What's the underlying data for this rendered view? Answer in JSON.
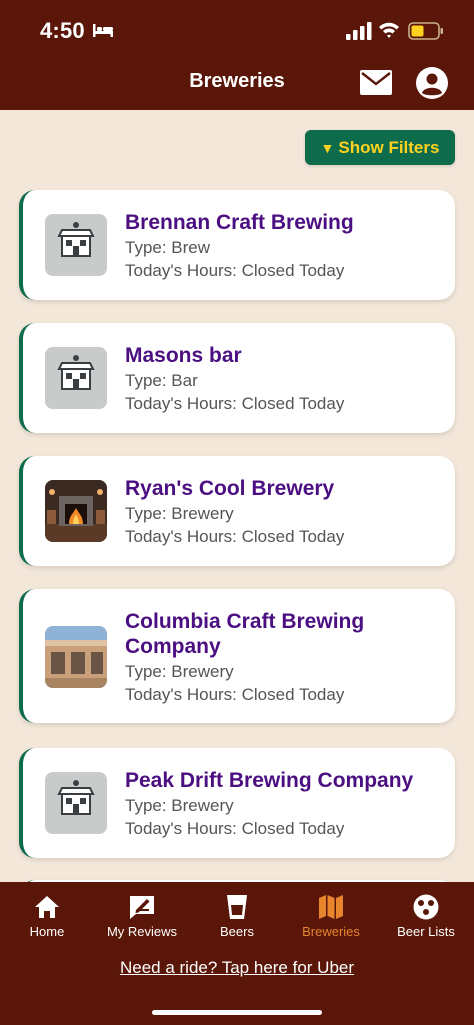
{
  "status_bar": {
    "time": "4:50"
  },
  "header": {
    "title": "Breweries"
  },
  "filters": {
    "label": "Show Filters",
    "icon": "triangle-down-icon"
  },
  "breweries": [
    {
      "name": "Brennan Craft Brewing",
      "type": "Type: Brew",
      "hours": "Today's Hours: Closed Today",
      "image": "storefront-placeholder"
    },
    {
      "name": "Masons bar",
      "type": "Type: Bar",
      "hours": "Today's Hours: Closed Today",
      "image": "storefront-placeholder"
    },
    {
      "name": "Ryan's Cool Brewery",
      "type": "Type: Brewery",
      "hours": "Today's Hours: Closed Today",
      "image": "fireplace-photo"
    },
    {
      "name": "Columbia Craft Brewing Company",
      "type": "Type: Brewery",
      "hours": "Today's Hours: Closed Today",
      "image": "building-photo"
    },
    {
      "name": "Peak Drift Brewing Company",
      "type": "Type: Brewery",
      "hours": "Today's Hours: Closed Today",
      "image": "storefront-placeholder"
    }
  ],
  "tabs": [
    {
      "label": "Home",
      "icon": "home-icon"
    },
    {
      "label": "My Reviews",
      "icon": "review-icon"
    },
    {
      "label": "Beers",
      "icon": "beer-cup-icon"
    },
    {
      "label": "Breweries",
      "icon": "map-icon",
      "active": true
    },
    {
      "label": "Beer Lists",
      "icon": "list-dots-icon"
    }
  ],
  "footer": {
    "uber_link": "Need a ride? Tap here for Uber"
  },
  "colors": {
    "header_bg": "#5a1608",
    "page_bg": "#f3e7da",
    "accent_green": "#0e6b4b",
    "filter_text": "#ffd21f",
    "brewery_name": "#4b0f82",
    "active_tab": "#e8852d"
  }
}
